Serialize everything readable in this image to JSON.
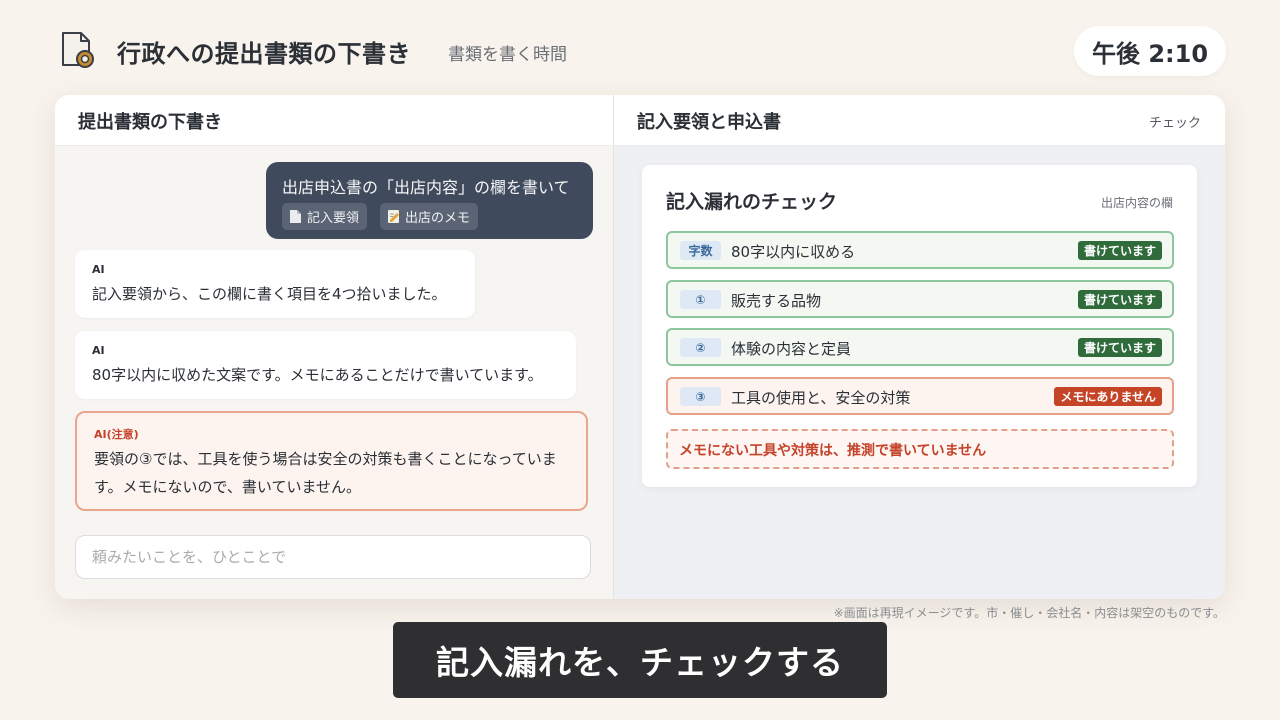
{
  "header": {
    "app_icon": "document-approval-icon",
    "title": "行政への提出書類の下書き",
    "subtitle": "書類を書く時間",
    "clock": "午後 2:10"
  },
  "left_pane": {
    "title": "提出書類の下書き",
    "user_message": {
      "text": "出店申込書の「出店内容」の欄を書いて",
      "attachments": [
        {
          "icon": "document-icon",
          "label": "記入要領"
        },
        {
          "icon": "memo-icon",
          "label": "出店のメモ"
        }
      ]
    },
    "ai_messages": [
      {
        "label": "AI",
        "text": "記入要領から、この欄に書く項目を4つ拾いました。"
      },
      {
        "label": "AI",
        "text": "80字以内に収めた文案です。メモにあることだけで書いています。"
      }
    ],
    "ai_warning": {
      "label": "AI(注意)",
      "text": "要領の③では、工具を使う場合は安全の対策も書くことになっています。メモにないので、書いていません。"
    },
    "input_placeholder": "頼みたいことを、ひとことで"
  },
  "right_pane": {
    "title": "記入要領と申込書",
    "tab": "チェック",
    "card": {
      "title": "記入漏れのチェック",
      "subtitle": "出店内容の欄",
      "rows": [
        {
          "tag": "字数",
          "text": "80字以内に収める",
          "status": "書けています",
          "ok": true
        },
        {
          "tag": "①",
          "text": "販売する品物",
          "status": "書けています",
          "ok": true
        },
        {
          "tag": "②",
          "text": "体験の内容と定員",
          "status": "書けています",
          "ok": true
        },
        {
          "tag": "③",
          "text": "工具の使用と、安全の対策",
          "status": "メモにありません",
          "ok": false
        }
      ],
      "warning": "メモにない工具や対策は、推測で書いていません"
    }
  },
  "footnote": "※画面は再現イメージです。市・催し・会社名・内容は架空のものです。",
  "caption": "記入漏れを、チェックする",
  "colors": {
    "background": "#f8f3ec",
    "user_bubble": "#3f4a5c",
    "ok_green": "#2f6b3b",
    "ng_red": "#c44425"
  }
}
